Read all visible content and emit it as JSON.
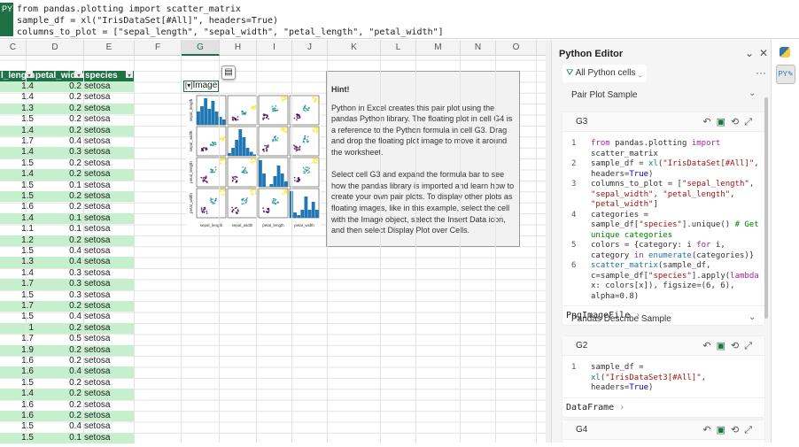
{
  "formula_bar": {
    "badge": "PY",
    "lines": [
      "from pandas.plotting import scatter_matrix",
      "sample_df = xl(\"IrisDataSet[#All]\", headers=True)",
      "columns_to_plot = [\"sepal_length\", \"sepal_width\", \"petal_length\", \"petal_width\"]"
    ]
  },
  "columns": [
    "C",
    "D",
    "E",
    "F",
    "G",
    "H",
    "I",
    "J",
    "K",
    "L",
    "M",
    "N",
    "O"
  ],
  "selected_column": "G",
  "table": {
    "headers": [
      "l_length",
      "petal_width",
      "species"
    ],
    "rows": [
      [
        "1.4",
        "0.2",
        "setosa"
      ],
      [
        "1.4",
        "0.2",
        "setosa"
      ],
      [
        "1.3",
        "0.2",
        "setosa"
      ],
      [
        "1.5",
        "0.2",
        "setosa"
      ],
      [
        "1.4",
        "0.2",
        "setosa"
      ],
      [
        "1.7",
        "0.4",
        "setosa"
      ],
      [
        "1.4",
        "0.3",
        "setosa"
      ],
      [
        "1.5",
        "0.2",
        "setosa"
      ],
      [
        "1.4",
        "0.2",
        "setosa"
      ],
      [
        "1.5",
        "0.1",
        "setosa"
      ],
      [
        "1.5",
        "0.2",
        "setosa"
      ],
      [
        "1.6",
        "0.2",
        "setosa"
      ],
      [
        "1.4",
        "0.1",
        "setosa"
      ],
      [
        "1.1",
        "0.1",
        "setosa"
      ],
      [
        "1.2",
        "0.2",
        "setosa"
      ],
      [
        "1.5",
        "0.4",
        "setosa"
      ],
      [
        "1.3",
        "0.4",
        "setosa"
      ],
      [
        "1.4",
        "0.3",
        "setosa"
      ],
      [
        "1.7",
        "0.3",
        "setosa"
      ],
      [
        "1.5",
        "0.3",
        "setosa"
      ],
      [
        "1.7",
        "0.2",
        "setosa"
      ],
      [
        "1.5",
        "0.4",
        "setosa"
      ],
      [
        "1",
        "0.2",
        "setosa"
      ],
      [
        "1.7",
        "0.5",
        "setosa"
      ],
      [
        "1.9",
        "0.2",
        "setosa"
      ],
      [
        "1.6",
        "0.2",
        "setosa"
      ],
      [
        "1.6",
        "0.4",
        "setosa"
      ],
      [
        "1.5",
        "0.2",
        "setosa"
      ],
      [
        "1.4",
        "0.2",
        "setosa"
      ],
      [
        "1.6",
        "0.2",
        "setosa"
      ],
      [
        "1.6",
        "0.2",
        "setosa"
      ],
      [
        "1.5",
        "0.4",
        "setosa"
      ],
      [
        "1.5",
        "0.1",
        "setosa"
      ]
    ]
  },
  "cell_g3": {
    "icon": "image-object-icon",
    "label": "Image"
  },
  "plot": {
    "axis_labels": [
      "sepal_length",
      "sepal_width",
      "petal_length",
      "petal_width"
    ],
    "colors": [
      "#440154",
      "#21918c",
      "#fde725"
    ],
    "hist_color": "#1f77b4"
  },
  "hint": {
    "title": "Hint!",
    "p1": "Python in Excel creates this pair plot using the pandas Python library. The floating plot in cell G4 is a reference to the Python formula in cell G3. Drag and drop the floating plot image to move it around the worksheet.",
    "p2": "Select cell G3 and expand the formula bar to see how the pandas library is imported and learn how to create your own pair plots. To display other plots as floating images, like in this example, select the cell with the Image object, select the Insert Data icon, and then select Display Plot over Cells."
  },
  "editor": {
    "title": "Python Editor",
    "filter": "All Python cells",
    "sections": [
      {
        "title": "Pair Plot Sample",
        "cell": "G3",
        "result": "PngImageFile"
      },
      {
        "title": "Pandas Describe Sample",
        "cell": "G2",
        "result": "DataFrame"
      },
      {
        "cell": "G4"
      }
    ]
  },
  "accent": "#1e7145"
}
